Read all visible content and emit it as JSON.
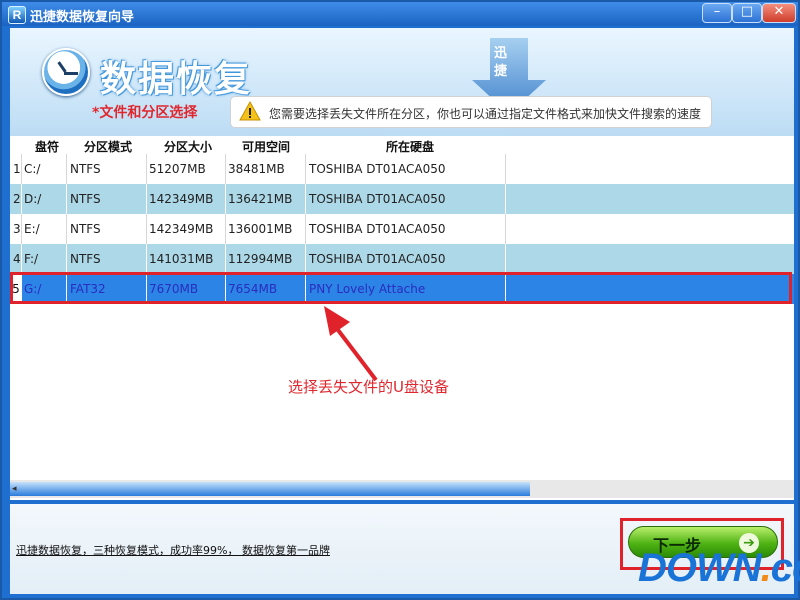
{
  "window": {
    "title": "迅捷数据恢复向导",
    "app_icon_letter": "R"
  },
  "window_controls": {
    "minimize": "–",
    "maximize": "□",
    "close": "✕"
  },
  "header": {
    "title": "数据恢复",
    "brand_chars": [
      "迅",
      "捷"
    ],
    "subtitle": "*文件和分区选择",
    "tip": "您需要选择丢失文件所在分区，你也可以通过指定文件格式来加快文件搜索的速度"
  },
  "table": {
    "columns": [
      "盘符",
      "分区模式",
      "分区大小",
      "可用空间",
      "所在硬盘"
    ],
    "rows": [
      {
        "index": "1",
        "drive": "C:/",
        "mode": "NTFS",
        "size": "51207MB",
        "free": "38481MB",
        "disk": "TOSHIBA DT01ACA050"
      },
      {
        "index": "2",
        "drive": "D:/",
        "mode": "NTFS",
        "size": "142349MB",
        "free": "136421MB",
        "disk": "TOSHIBA DT01ACA050"
      },
      {
        "index": "3",
        "drive": "E:/",
        "mode": "NTFS",
        "size": "142349MB",
        "free": "136001MB",
        "disk": "TOSHIBA DT01ACA050"
      },
      {
        "index": "4",
        "drive": "F:/",
        "mode": "NTFS",
        "size": "141031MB",
        "free": "112994MB",
        "disk": "TOSHIBA DT01ACA050"
      },
      {
        "index": "5",
        "drive": "G:/",
        "mode": "FAT32",
        "size": "7670MB",
        "free": "7654MB",
        "disk": "PNY Lovely Attache"
      }
    ],
    "selected_index": 4
  },
  "annotation": {
    "callout": "选择丢失文件的U盘设备"
  },
  "footer": {
    "tagline": "迅捷数据恢复，三种恢复模式，成功率99%， 数据恢复第一品牌",
    "next_button": "下一步",
    "next_arrow": "➔"
  },
  "watermark": {
    "brand": "DOWN",
    "dot": ".",
    "suffix": "cc"
  },
  "colors": {
    "accent": "#1f6fd0",
    "highlight": "#e0232b",
    "selected_row": "#2b84e6",
    "alt_row": "#add8e8"
  }
}
